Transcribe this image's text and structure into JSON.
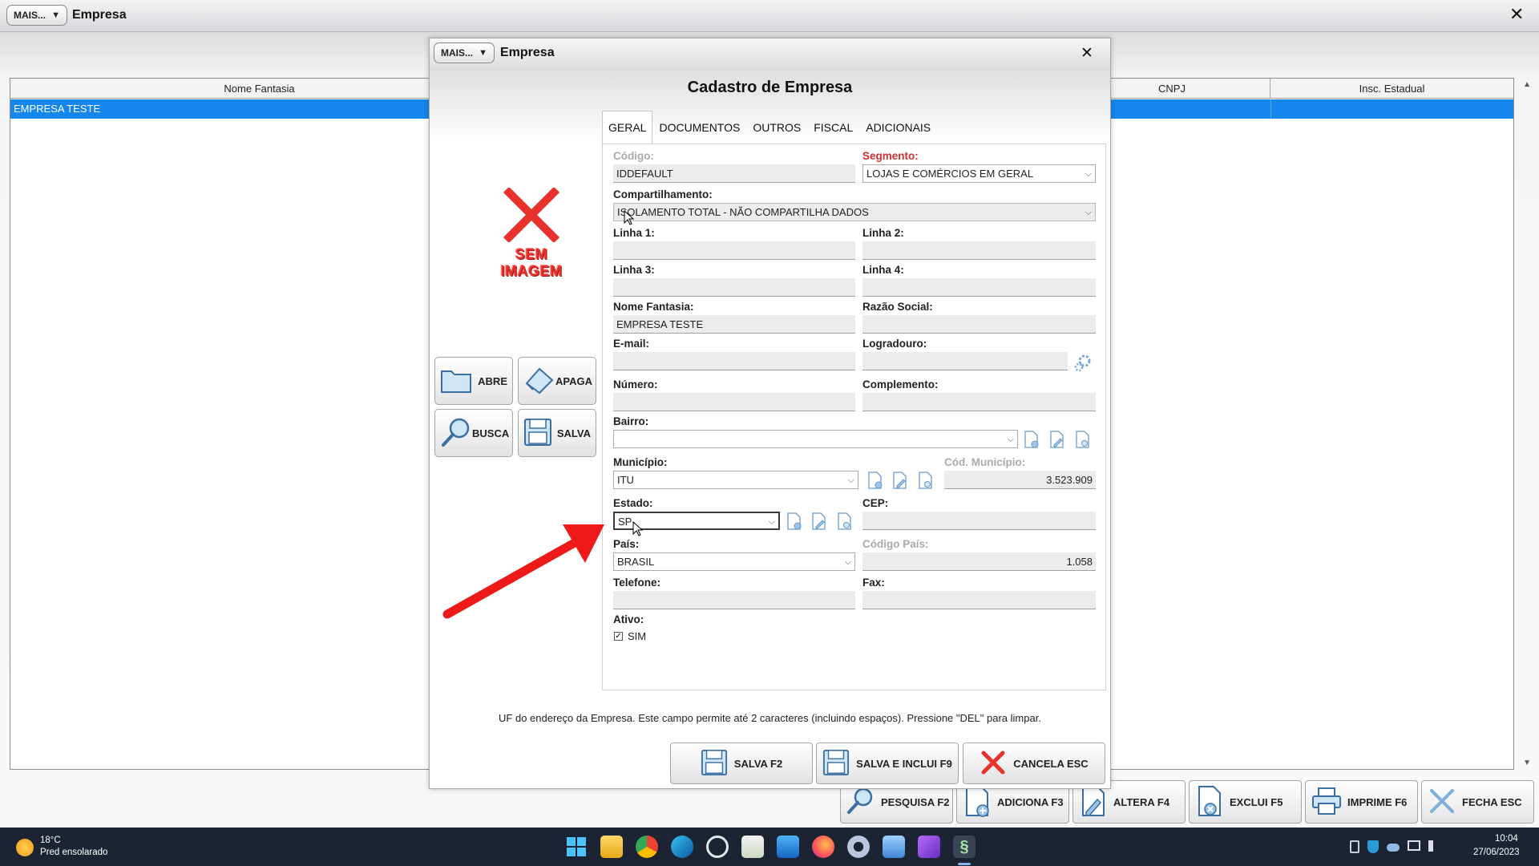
{
  "main_window": {
    "mais_label": "MAIS...",
    "title": "Empresa",
    "grid": {
      "columns": [
        "Nome Fantasia",
        "CNPJ",
        "Insc. Estadual"
      ],
      "rows": [
        {
          "nome_fantasia": "EMPRESA TESTE"
        }
      ]
    },
    "buttons": {
      "pesquisa": "PESQUISA F2",
      "adiciona": "ADICIONA F3",
      "altera": "ALTERA F4",
      "exclui": "EXCLUI F5",
      "imprime": "IMPRIME F6",
      "fecha": "FECHA ESC"
    }
  },
  "dialog": {
    "mais_label": "MAIS...",
    "title": "Empresa",
    "heading": "Cadastro de Empresa",
    "no_image": [
      "SEM",
      "IMAGEM"
    ],
    "side_buttons": {
      "abre": "ABRE",
      "apaga": "APAGA",
      "busca": "BUSCA",
      "salva": "SALVA"
    },
    "tabs": [
      "GERAL",
      "DOCUMENTOS",
      "OUTROS",
      "FISCAL",
      "ADICIONAIS"
    ],
    "active_tab": "GERAL",
    "form": {
      "codigo": {
        "label": "Código:",
        "value": "IDDEFAULT"
      },
      "segmento": {
        "label": "Segmento:",
        "value": "LOJAS E COMÉRCIOS EM GERAL"
      },
      "compartilhamento": {
        "label": "Compartilhamento:",
        "value": "ISOLAMENTO TOTAL - NÃO COMPARTILHA DADOS"
      },
      "linha1": {
        "label": "Linha 1:",
        "value": ""
      },
      "linha2": {
        "label": "Linha 2:",
        "value": ""
      },
      "linha3": {
        "label": "Linha 3:",
        "value": ""
      },
      "linha4": {
        "label": "Linha 4:",
        "value": ""
      },
      "nome_fantasia": {
        "label": "Nome Fantasia:",
        "value": "EMPRESA TESTE"
      },
      "razao_social": {
        "label": "Razão Social:",
        "value": ""
      },
      "email": {
        "label": "E-mail:",
        "value": ""
      },
      "logradouro": {
        "label": "Logradouro:",
        "value": ""
      },
      "numero": {
        "label": "Número:",
        "value": ""
      },
      "complemento": {
        "label": "Complemento:",
        "value": ""
      },
      "bairro": {
        "label": "Bairro:",
        "value": ""
      },
      "municipio": {
        "label": "Município:",
        "value": "ITU"
      },
      "cod_municipio": {
        "label": "Cód. Município:",
        "value": "3.523.909"
      },
      "estado": {
        "label": "Estado:",
        "value": "SP"
      },
      "cep": {
        "label": "CEP:",
        "value": ""
      },
      "pais": {
        "label": "País:",
        "value": "BRASIL"
      },
      "codigo_pais": {
        "label": "Código País:",
        "value": "1.058"
      },
      "telefone": {
        "label": "Telefone:",
        "value": ""
      },
      "fax": {
        "label": "Fax:",
        "value": ""
      },
      "ativo": {
        "label": "Ativo:",
        "option": "SIM",
        "checked": true
      }
    },
    "hint": "UF do endereço da Empresa. Este campo permite até 2 caracteres (incluindo espaços). Pressione \"DEL\" para limpar.",
    "buttons": {
      "salva": "SALVA F2",
      "salva_inclui": "SALVA E INCLUI F9",
      "cancela": "CANCELA ESC"
    }
  },
  "taskbar": {
    "weather_temp": "18°C",
    "weather_desc": "Pred ensolarado",
    "time": "10:04",
    "date": "27/06/2023"
  }
}
